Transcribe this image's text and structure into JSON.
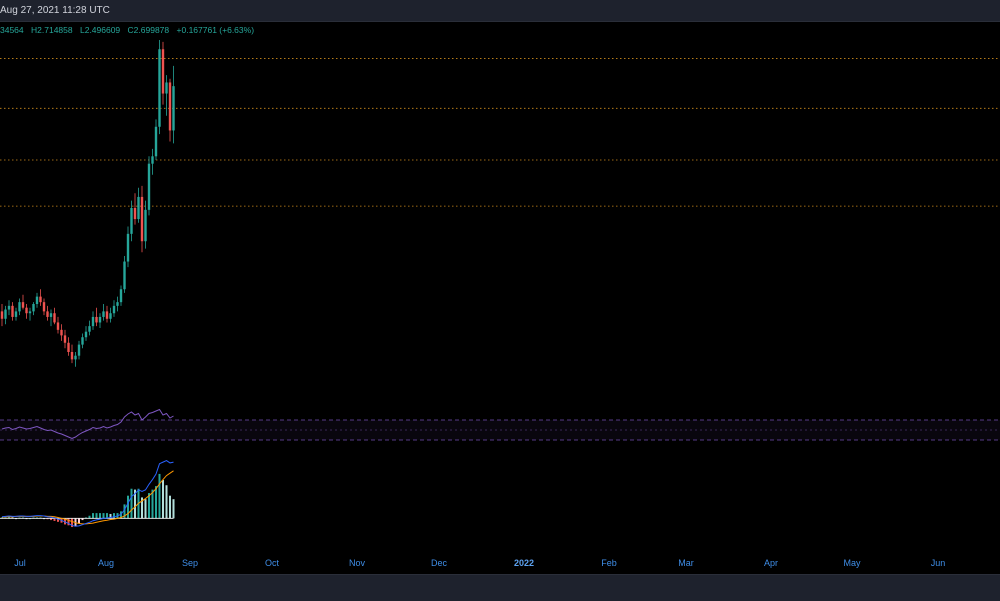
{
  "header": {
    "datetime": "Aug 27, 2021 11:28 UTC"
  },
  "ohlc": {
    "open": "34564",
    "high": "H2.714858",
    "low": "L2.496609",
    "close": "C2.699878",
    "change": "+0.167761 (+6.63%)"
  },
  "colors": {
    "up": "#26a69a",
    "down": "#ef5350",
    "level_line": "#f5a623",
    "rsi": "#7e57c2",
    "macd": "#2962ff",
    "signal": "#ff9800",
    "axis_label": "#3f8ee8",
    "panel": "#1e222d"
  },
  "time_axis": {
    "labels": [
      "Jul",
      "Aug",
      "Sep",
      "Oct",
      "Nov",
      "Dec",
      "2022",
      "Feb",
      "Mar",
      "Apr",
      "May",
      "Jun"
    ]
  },
  "chart_data": {
    "type": "candlestick",
    "price_panel": {
      "description_levels": "horizontal dotted resistance/support lines",
      "horizontal_levels": [
        2.75,
        2.48,
        2.2,
        1.95
      ],
      "ylim": [
        0.9,
        2.85
      ],
      "candles": [
        [
          1.38,
          1.42,
          1.3,
          1.34
        ],
        [
          1.34,
          1.41,
          1.31,
          1.39
        ],
        [
          1.39,
          1.44,
          1.36,
          1.41
        ],
        [
          1.41,
          1.43,
          1.33,
          1.35
        ],
        [
          1.35,
          1.4,
          1.33,
          1.38
        ],
        [
          1.38,
          1.45,
          1.36,
          1.43
        ],
        [
          1.43,
          1.47,
          1.39,
          1.4
        ],
        [
          1.4,
          1.42,
          1.34,
          1.37
        ],
        [
          1.37,
          1.4,
          1.33,
          1.38
        ],
        [
          1.38,
          1.43,
          1.36,
          1.42
        ],
        [
          1.42,
          1.48,
          1.4,
          1.46
        ],
        [
          1.46,
          1.5,
          1.41,
          1.43
        ],
        [
          1.43,
          1.45,
          1.36,
          1.38
        ],
        [
          1.38,
          1.41,
          1.33,
          1.35
        ],
        [
          1.35,
          1.39,
          1.3,
          1.37
        ],
        [
          1.37,
          1.4,
          1.31,
          1.32
        ],
        [
          1.32,
          1.35,
          1.26,
          1.28
        ],
        [
          1.28,
          1.31,
          1.22,
          1.25
        ],
        [
          1.25,
          1.28,
          1.18,
          1.21
        ],
        [
          1.21,
          1.24,
          1.14,
          1.16
        ],
        [
          1.16,
          1.2,
          1.1,
          1.12
        ],
        [
          1.12,
          1.16,
          1.08,
          1.14
        ],
        [
          1.14,
          1.22,
          1.12,
          1.2
        ],
        [
          1.2,
          1.26,
          1.18,
          1.24
        ],
        [
          1.24,
          1.3,
          1.22,
          1.27
        ],
        [
          1.27,
          1.33,
          1.25,
          1.3
        ],
        [
          1.3,
          1.38,
          1.28,
          1.35
        ],
        [
          1.35,
          1.4,
          1.3,
          1.32
        ],
        [
          1.32,
          1.37,
          1.29,
          1.35
        ],
        [
          1.35,
          1.42,
          1.33,
          1.38
        ],
        [
          1.38,
          1.41,
          1.32,
          1.34
        ],
        [
          1.34,
          1.4,
          1.32,
          1.37
        ],
        [
          1.37,
          1.44,
          1.35,
          1.41
        ],
        [
          1.41,
          1.46,
          1.38,
          1.43
        ],
        [
          1.43,
          1.52,
          1.41,
          1.5
        ],
        [
          1.5,
          1.68,
          1.48,
          1.65
        ],
        [
          1.65,
          1.84,
          1.62,
          1.8
        ],
        [
          1.8,
          1.98,
          1.76,
          1.94
        ],
        [
          1.94,
          2.02,
          1.85,
          1.88
        ],
        [
          1.88,
          2.05,
          1.86,
          2.0
        ],
        [
          2.0,
          2.06,
          1.7,
          1.76
        ],
        [
          1.76,
          1.98,
          1.72,
          1.93
        ],
        [
          1.93,
          2.22,
          1.9,
          2.18
        ],
        [
          2.18,
          2.26,
          2.12,
          2.22
        ],
        [
          2.22,
          2.42,
          2.2,
          2.38
        ],
        [
          2.38,
          2.85,
          2.34,
          2.8
        ],
        [
          2.8,
          2.84,
          2.5,
          2.56
        ],
        [
          2.56,
          2.66,
          2.44,
          2.62
        ],
        [
          2.62,
          2.64,
          2.3,
          2.36
        ],
        [
          2.36,
          2.71,
          2.29,
          2.6
        ]
      ]
    },
    "rsi_panel": {
      "bands": [
        70,
        50,
        30
      ],
      "ylim": [
        0,
        100
      ],
      "values": [
        52,
        54,
        55,
        51,
        53,
        56,
        54,
        52,
        53,
        55,
        57,
        54,
        51,
        49,
        50,
        47,
        44,
        42,
        39,
        36,
        33,
        36,
        41,
        45,
        48,
        51,
        55,
        53,
        54,
        57,
        54,
        56,
        59,
        61,
        66,
        76,
        82,
        86,
        80,
        83,
        70,
        76,
        83,
        85,
        88,
        91,
        80,
        83,
        74,
        78
      ]
    },
    "macd_panel": {
      "ylim": [
        -0.08,
        0.16
      ],
      "macd": [
        0.004,
        0.005,
        0.006,
        0.005,
        0.005,
        0.006,
        0.006,
        0.005,
        0.005,
        0.006,
        0.007,
        0.007,
        0.006,
        0.004,
        0.003,
        0.001,
        -0.002,
        -0.005,
        -0.009,
        -0.013,
        -0.018,
        -0.02,
        -0.019,
        -0.016,
        -0.013,
        -0.01,
        -0.006,
        -0.004,
        -0.002,
        0.0,
        0.001,
        0.002,
        0.004,
        0.006,
        0.01,
        0.022,
        0.038,
        0.055,
        0.062,
        0.072,
        0.068,
        0.072,
        0.086,
        0.098,
        0.112,
        0.138,
        0.142,
        0.146,
        0.14,
        0.142
      ],
      "signal": [
        0.003,
        0.004,
        0.004,
        0.004,
        0.005,
        0.005,
        0.005,
        0.005,
        0.005,
        0.005,
        0.006,
        0.006,
        0.006,
        0.005,
        0.005,
        0.004,
        0.002,
        0.0,
        -0.002,
        -0.005,
        -0.008,
        -0.011,
        -0.013,
        -0.014,
        -0.014,
        -0.013,
        -0.012,
        -0.01,
        -0.008,
        -0.006,
        -0.005,
        -0.003,
        -0.002,
        0.0,
        0.002,
        0.006,
        0.012,
        0.021,
        0.029,
        0.038,
        0.044,
        0.05,
        0.057,
        0.065,
        0.075,
        0.087,
        0.098,
        0.108,
        0.114,
        0.12
      ],
      "histogram": [
        0.001,
        0.001,
        0.002,
        0.001,
        0.0,
        0.001,
        0.001,
        0.0,
        0.0,
        0.001,
        0.001,
        0.001,
        0.0,
        -0.001,
        -0.002,
        -0.003,
        -0.004,
        -0.005,
        -0.007,
        -0.008,
        -0.01,
        -0.009,
        -0.006,
        -0.002,
        0.001,
        0.003,
        0.006,
        0.006,
        0.006,
        0.006,
        0.006,
        0.005,
        0.006,
        0.006,
        0.008,
        0.016,
        0.026,
        0.034,
        0.033,
        0.034,
        0.024,
        0.022,
        0.029,
        0.033,
        0.037,
        0.051,
        0.044,
        0.038,
        0.026,
        0.022
      ],
      "flat_line": 0.0
    }
  }
}
